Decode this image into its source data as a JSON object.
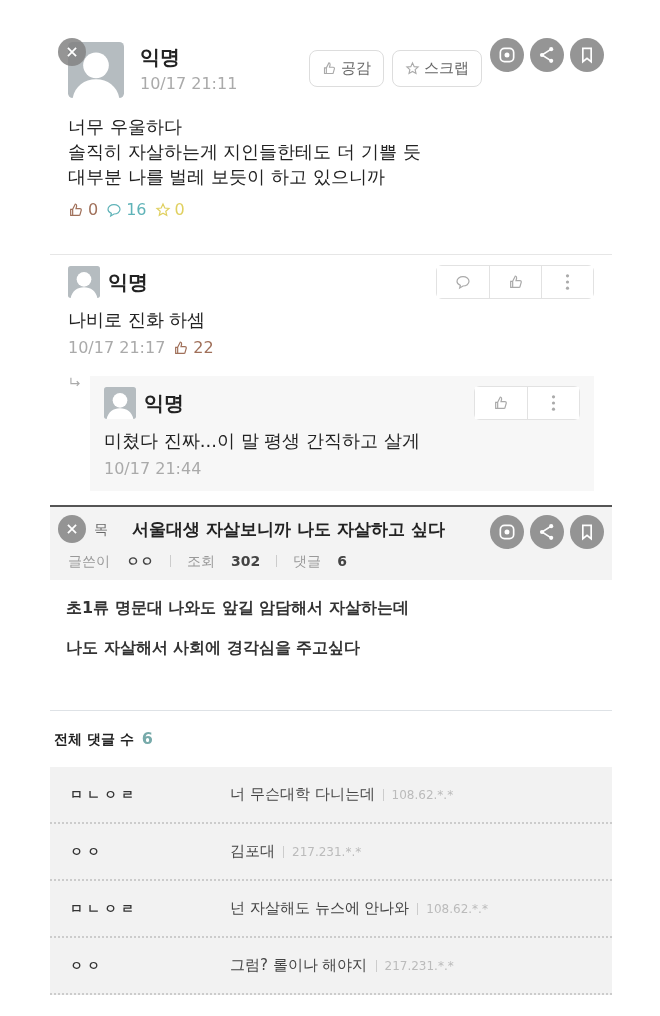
{
  "post": {
    "author": "익명",
    "time": "10/17 21:11",
    "body_lines": [
      "너무 우울하다",
      "솔직히 자살하는게 지인들한테도 더 기쁠 듯",
      "대부분 나를 벌레 보듯이 하고 있으니까"
    ],
    "buttons": [
      {
        "kind": "like",
        "label": "공감"
      },
      {
        "kind": "star",
        "label": "스크랩"
      }
    ],
    "stats": [
      {
        "kind": "like",
        "value": "0",
        "color": "#a0705a"
      },
      {
        "kind": "comment",
        "value": "16",
        "color": "#5fb3b8"
      },
      {
        "kind": "star",
        "value": "0",
        "color": "#e0d060"
      }
    ]
  },
  "comments": [
    {
      "author": "익명",
      "text": "나비로 진화 하셈",
      "time": "10/17 21:17",
      "likes": "22",
      "replies": [
        {
          "author": "익명",
          "text": "미쳤다 진짜...이 말 평생 간직하고 살게",
          "time": "10/17 21:44"
        }
      ]
    }
  ],
  "board_post": {
    "title_label": "목",
    "title": "서울대생 자살보니까 나도 자살하고 싶다",
    "meta": [
      {
        "label": "글쓴이",
        "value": "ㅇㅇ"
      },
      {
        "label": "조회",
        "value": "302"
      },
      {
        "label": "댓글",
        "value": "6"
      }
    ],
    "body_lines": [
      "초1류 명문대 나와도 앞길 암담해서 자살하는데",
      "나도 자살해서 사회에 경각심을 주고싶다"
    ]
  },
  "comment_list": {
    "label": "전체 댓글 수",
    "count": "6",
    "rows": [
      {
        "author": "ㅁㄴㅇㄹ",
        "text": "너 무슨대학 다니는데",
        "ip": "108.62.*.*"
      },
      {
        "author": "ㅇㅇ",
        "text": "김포대",
        "ip": "217.231.*.*"
      },
      {
        "author": "ㅁㄴㅇㄹ",
        "text": "넌 자살해도 뉴스에 안나와",
        "ip": "108.62.*.*"
      },
      {
        "author": "ㅇㅇ",
        "text": "그럼? 롤이나 해야지",
        "ip": "217.231.*.*"
      }
    ]
  }
}
